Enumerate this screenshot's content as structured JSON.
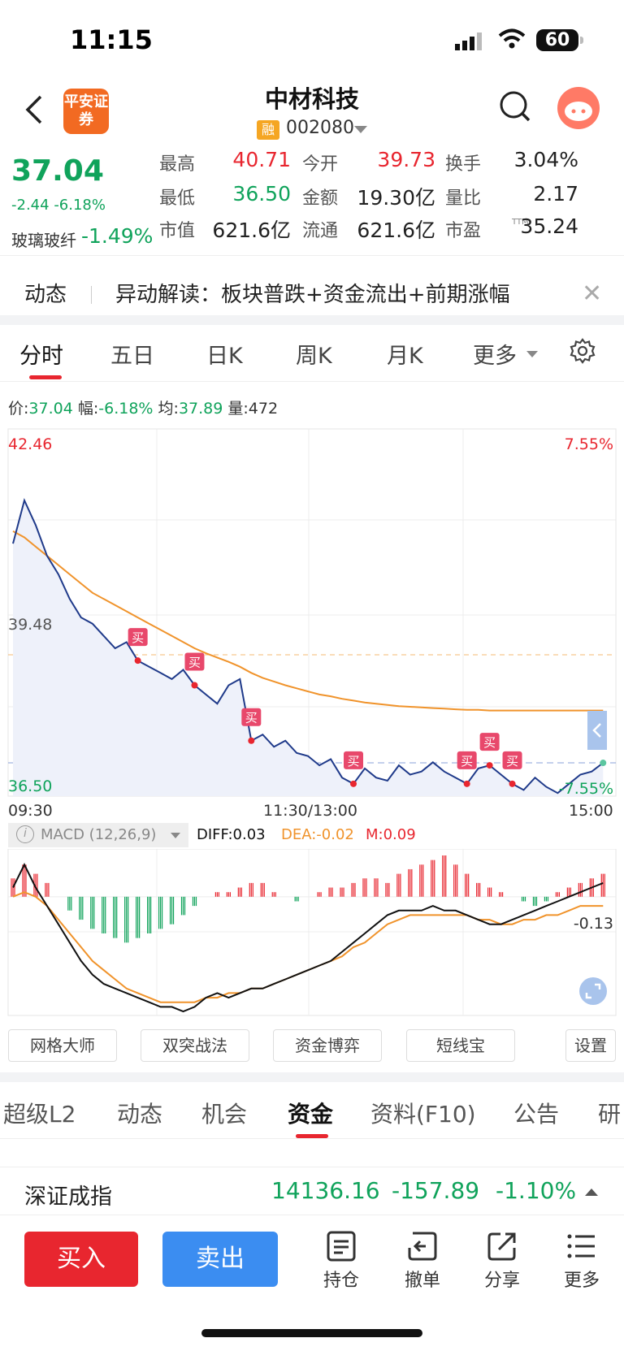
{
  "status_bar": {
    "time": "11:15",
    "battery": "60"
  },
  "header": {
    "broker_logo": "平安证券",
    "stock_name": "中材科技",
    "margin_badge": "融",
    "stock_code": "002080"
  },
  "quote": {
    "last_price": "37.04",
    "change": "-2.44",
    "change_pct": "-6.18%",
    "sector_name": "玻璃玻纤",
    "sector_change": "-1.49%",
    "stats": [
      {
        "label": "最高",
        "value": "40.71",
        "color": "#e8262f"
      },
      {
        "label": "今开",
        "value": "39.73",
        "color": "#e8262f"
      },
      {
        "label": "换手",
        "value": "3.04%",
        "color": "#222222"
      },
      {
        "label": "最低",
        "value": "36.50",
        "color": "#10a35b"
      },
      {
        "label": "金额",
        "value": "19.30亿",
        "color": "#222222"
      },
      {
        "label": "量比",
        "value": "2.17",
        "color": "#222222"
      },
      {
        "label": "市值",
        "value": "621.6亿",
        "color": "#222222"
      },
      {
        "label": "流通",
        "value": "621.6亿",
        "color": "#222222"
      },
      {
        "label": "市盈",
        "value": "35.24",
        "color": "#222222"
      }
    ],
    "pe_tag": "TTM"
  },
  "news": {
    "tag": "动态",
    "text": "异动解读：板块普跌+资金流出+前期涨幅"
  },
  "chart_tabs": [
    "分时",
    "五日",
    "日K",
    "周K",
    "月K",
    "更多"
  ],
  "info_line": {
    "price_label": "价:",
    "price": "37.04",
    "range_label": "幅:",
    "range": "-6.18%",
    "avg_label": "均:",
    "avg": "37.89",
    "vol_label": "量:",
    "vol": "472"
  },
  "chart_data": {
    "type": "line",
    "title": "",
    "y_high": "42.46",
    "y_mid": "39.48",
    "y_low": "36.50",
    "pct_high": "7.55%",
    "pct_low": "-7.55%",
    "ylim": [
      36.5,
      42.46
    ],
    "prev_close": 39.48,
    "x_ticks": [
      "09:30",
      "11:30/13:00",
      "15:00"
    ],
    "series": [
      {
        "values": [
          40.6,
          41.3,
          40.9,
          40.4,
          40.1,
          39.7,
          39.4,
          39.3,
          39.1,
          38.9,
          39.0,
          38.7,
          38.6,
          38.5,
          38.4,
          38.55,
          38.3,
          38.15,
          38.0,
          38.3,
          38.4,
          37.4,
          37.5,
          37.3,
          37.4,
          37.2,
          37.15,
          37.0,
          37.1,
          36.8,
          36.7,
          36.95,
          36.8,
          36.75,
          37.0,
          36.85,
          36.9,
          37.05,
          36.9,
          36.8,
          36.7,
          36.95,
          37.0,
          36.85,
          36.7,
          36.6,
          36.8,
          36.65,
          36.55,
          36.7,
          36.85,
          36.9,
          37.04
        ]
      },
      {
        "values": [
          40.8,
          40.7,
          40.55,
          40.4,
          40.25,
          40.1,
          39.95,
          39.8,
          39.7,
          39.6,
          39.5,
          39.4,
          39.3,
          39.2,
          39.1,
          39.0,
          38.9,
          38.82,
          38.75,
          38.68,
          38.6,
          38.5,
          38.42,
          38.36,
          38.3,
          38.25,
          38.2,
          38.15,
          38.12,
          38.08,
          38.05,
          38.02,
          38.0,
          37.98,
          37.96,
          37.95,
          37.94,
          37.93,
          37.92,
          37.91,
          37.9,
          37.9,
          37.89,
          37.89,
          37.89,
          37.89,
          37.89,
          37.89,
          37.89,
          37.89,
          37.89,
          37.89,
          37.89
        ]
      }
    ],
    "buy_marks": [
      11,
      16,
      21,
      30,
      40,
      42,
      44
    ],
    "buy_label": "买"
  },
  "macd": {
    "title": "MACD (12,26,9)",
    "diff": "DIFF:0.03",
    "dea": "DEA:-0.02",
    "m": "M:0.09",
    "axis_label": "-0.13",
    "ylim": [
      -0.25,
      0.09
    ],
    "hist": [
      0.04,
      0.07,
      0.05,
      0.03,
      0.0,
      -0.03,
      -0.05,
      -0.07,
      -0.08,
      -0.09,
      -0.1,
      -0.09,
      -0.08,
      -0.07,
      -0.06,
      -0.04,
      -0.02,
      0.0,
      0.01,
      0.01,
      0.02,
      0.03,
      0.03,
      0.01,
      0.0,
      -0.01,
      0.0,
      0.01,
      0.02,
      0.02,
      0.03,
      0.04,
      0.04,
      0.03,
      0.05,
      0.06,
      0.07,
      0.08,
      0.09,
      0.07,
      0.05,
      0.03,
      0.02,
      0.01,
      0.0,
      -0.01,
      -0.02,
      -0.01,
      0.01,
      0.02,
      0.03,
      0.04,
      0.05
    ],
    "diff_line": [
      0.02,
      0.07,
      0.02,
      -0.02,
      -0.06,
      -0.1,
      -0.14,
      -0.17,
      -0.19,
      -0.2,
      -0.21,
      -0.22,
      -0.23,
      -0.24,
      -0.24,
      -0.25,
      -0.24,
      -0.22,
      -0.21,
      -0.22,
      -0.21,
      -0.2,
      -0.2,
      -0.19,
      -0.18,
      -0.17,
      -0.16,
      -0.15,
      -0.14,
      -0.12,
      -0.1,
      -0.08,
      -0.06,
      -0.04,
      -0.03,
      -0.03,
      -0.03,
      -0.02,
      -0.03,
      -0.03,
      -0.04,
      -0.05,
      -0.06,
      -0.06,
      -0.05,
      -0.04,
      -0.03,
      -0.02,
      -0.01,
      0.0,
      0.01,
      0.02,
      0.03
    ],
    "dea_line": [
      0.0,
      0.01,
      0.0,
      -0.02,
      -0.05,
      -0.08,
      -0.11,
      -0.14,
      -0.16,
      -0.18,
      -0.2,
      -0.21,
      -0.22,
      -0.23,
      -0.23,
      -0.23,
      -0.23,
      -0.22,
      -0.22,
      -0.21,
      -0.21,
      -0.2,
      -0.2,
      -0.19,
      -0.18,
      -0.17,
      -0.16,
      -0.15,
      -0.14,
      -0.13,
      -0.11,
      -0.1,
      -0.08,
      -0.06,
      -0.05,
      -0.04,
      -0.04,
      -0.04,
      -0.04,
      -0.04,
      -0.04,
      -0.05,
      -0.05,
      -0.06,
      -0.06,
      -0.05,
      -0.05,
      -0.04,
      -0.04,
      -0.03,
      -0.02,
      -0.02,
      -0.02
    ]
  },
  "strategy_buttons": [
    "网格大师",
    "双突战法",
    "资金博弈",
    "短线宝",
    "设置"
  ],
  "info_tabs": [
    "超级L2",
    "动态",
    "机会",
    "资金",
    "资料(F10)",
    "公告",
    "研"
  ],
  "index_bar": {
    "name": "深证成指",
    "value": "14136.16",
    "change": "-157.89",
    "pct": "-1.10%"
  },
  "actions": {
    "buy": "买入",
    "sell": "卖出",
    "holdings": "持仓",
    "cancel": "撤单",
    "share": "分享",
    "more": "更多"
  },
  "colors": {
    "up": "#e8262f",
    "down": "#10a35b",
    "price_line": "#1f3a8a",
    "avg_line": "#f0932b",
    "sell_blue": "#3b8df1"
  }
}
